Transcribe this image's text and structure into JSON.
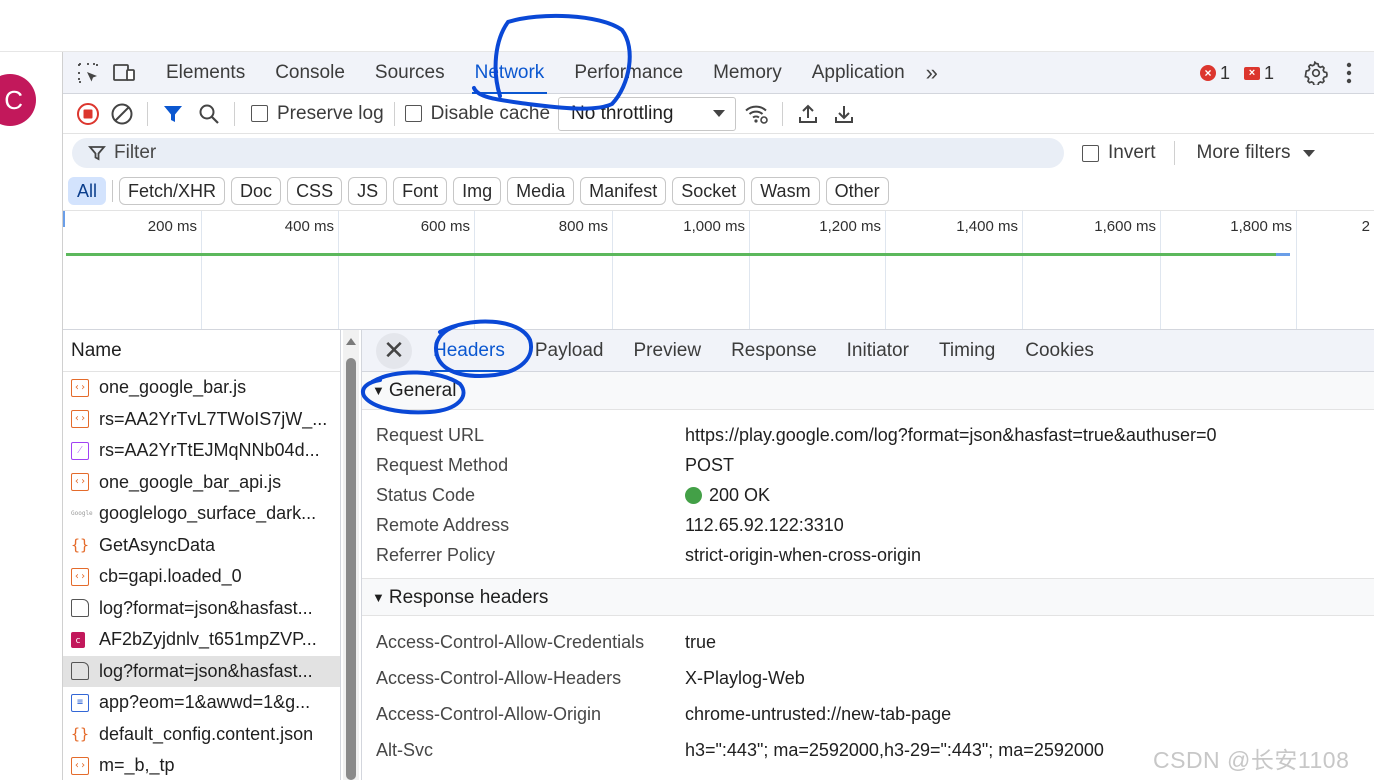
{
  "page": {
    "avatar_letter": "C"
  },
  "devtools": {
    "tabs": [
      {
        "label": "Elements"
      },
      {
        "label": "Console"
      },
      {
        "label": "Sources"
      },
      {
        "label": "Network"
      },
      {
        "label": "Performance"
      },
      {
        "label": "Memory"
      },
      {
        "label": "Application"
      }
    ],
    "error_count": "1",
    "issue_count": "1",
    "more_tabs_glyph": "»"
  },
  "toolbar": {
    "preserve_log": "Preserve log",
    "disable_cache": "Disable cache",
    "throttling": "No throttling"
  },
  "filter": {
    "placeholder": "Filter",
    "invert": "Invert",
    "more_filters": "More filters"
  },
  "chips": {
    "all": "All",
    "types": [
      "Fetch/XHR",
      "Doc",
      "CSS",
      "JS",
      "Font",
      "Img",
      "Media",
      "Manifest",
      "Socket",
      "Wasm",
      "Other"
    ]
  },
  "overview": {
    "ticks": [
      "200 ms",
      "400 ms",
      "600 ms",
      "800 ms",
      "1,000 ms",
      "1,200 ms",
      "1,400 ms",
      "1,600 ms",
      "1,800 ms",
      "2"
    ]
  },
  "names": {
    "header": "Name",
    "rows": [
      {
        "text": "one_google_bar.js",
        "icon": "js-file-icon"
      },
      {
        "text": "rs=AA2YrTvL7TWoIS7jW_...",
        "icon": "js-file-icon"
      },
      {
        "text": "rs=AA2YrTtEJMqNNb04d...",
        "icon": "css-file-icon"
      },
      {
        "text": "one_google_bar_api.js",
        "icon": "js-file-icon"
      },
      {
        "text": "googlelogo_surface_dark...",
        "icon": "image-file-icon"
      },
      {
        "text": "GetAsyncData",
        "icon": "json-file-icon"
      },
      {
        "text": "cb=gapi.loaded_0",
        "icon": "js-file-icon"
      },
      {
        "text": "log?format=json&hasfast...",
        "icon": "document-icon"
      },
      {
        "text": "AF2bZyjdnlv_t651mpZVP...",
        "icon": "favicon-icon"
      },
      {
        "text": "log?format=json&hasfast...",
        "icon": "document-icon"
      },
      {
        "text": "app?eom=1&awwd=1&g...",
        "icon": "doc-file-icon"
      },
      {
        "text": "default_config.content.json",
        "icon": "json-file-icon"
      },
      {
        "text": "m=_b,_tp",
        "icon": "js-file-icon"
      }
    ]
  },
  "details": {
    "close_glyph": "✕",
    "tabs": [
      "Headers",
      "Payload",
      "Preview",
      "Response",
      "Initiator",
      "Timing",
      "Cookies"
    ],
    "general": {
      "title": "General",
      "rows": [
        {
          "key": "Request URL",
          "value": "https://play.google.com/log?format=json&hasfast=true&authuser=0"
        },
        {
          "key": "Request Method",
          "value": "POST"
        },
        {
          "key": "Status Code",
          "value": "200 OK"
        },
        {
          "key": "Remote Address",
          "value": "112.65.92.122:3310"
        },
        {
          "key": "Referrer Policy",
          "value": "strict-origin-when-cross-origin"
        }
      ]
    },
    "response_headers": {
      "title": "Response headers",
      "rows": [
        {
          "key": "Access-Control-Allow-Credentials",
          "value": "true"
        },
        {
          "key": "Access-Control-Allow-Headers",
          "value": "X-Playlog-Web"
        },
        {
          "key": "Access-Control-Allow-Origin",
          "value": "chrome-untrusted://new-tab-page"
        },
        {
          "key": "Alt-Svc",
          "value": "h3=\":443\"; ma=2592000,h3-29=\":443\"; ma=2592000"
        }
      ]
    }
  },
  "watermark": "CSDN @长安1108",
  "colors": {
    "accent": "#0b57d0",
    "annotation": "#0a48d6",
    "status_ok": "#43a047",
    "error": "#dc362e"
  }
}
